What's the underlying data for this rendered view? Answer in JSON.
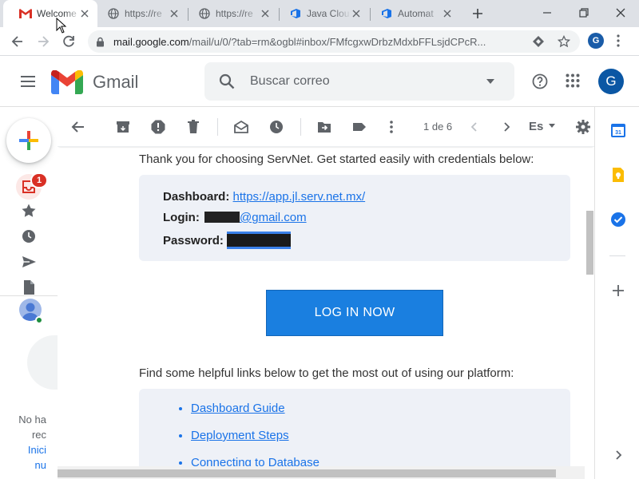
{
  "browser": {
    "tabs": [
      {
        "title": "Welcome",
        "favicon": "gmail-icon",
        "active": true
      },
      {
        "title": "https://re",
        "favicon": "globe-icon",
        "active": false
      },
      {
        "title": "https://re",
        "favicon": "globe-icon",
        "active": false
      },
      {
        "title": "Java Clou",
        "favicon": "azure-devops-icon",
        "active": false
      },
      {
        "title": "Automat",
        "favicon": "azure-devops-icon",
        "active": false
      }
    ],
    "url_host": "mail.google.com",
    "url_path": "/mail/u/0/?tab=rm&ogbl#inbox/FMfcgxwDrbzMdxbFFLsjdCPcR...",
    "profile_initial": "G"
  },
  "gmail": {
    "app_name": "Gmail",
    "search_placeholder": "Buscar correo",
    "avatar_initial": "G",
    "inbox_badge": "1",
    "pager": "1 de 6",
    "language": "Es"
  },
  "hangouts": {
    "line1": "No ha",
    "line2": "rec",
    "line3": "Inici",
    "line4": "nu"
  },
  "email": {
    "intro": "Thank you for choosing ServNet. Get started easily with credentials below:",
    "dashboard_label": "Dashboard:",
    "dashboard_url": "https://app.jl.serv.net.mx/",
    "login_label": "Login:",
    "login_suffix": "@gmail.com",
    "password_label": "Password:",
    "login_button": "LOG IN NOW",
    "links_intro": "Find some helpful links below to get the most out of using our platform:",
    "links": [
      "Dashboard Guide",
      "Deployment Steps",
      "Connecting to Database"
    ]
  },
  "colors": {
    "gmail_red": "#d93025",
    "button_blue": "#1a7fe0",
    "link_blue": "#1a73e8",
    "box_bg": "#eef1f7"
  }
}
